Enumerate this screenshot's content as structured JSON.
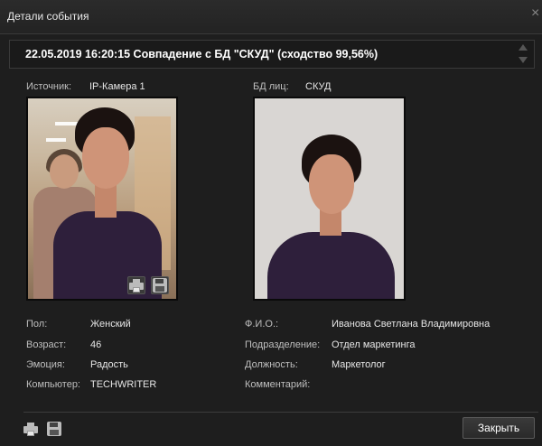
{
  "window": {
    "title": "Детали события",
    "close_glyph": "×"
  },
  "event": {
    "header": "22.05.2019 16:20:15 Совпадение с БД \"СКУД\" (сходство 99,56%)"
  },
  "source": {
    "label": "Источник:",
    "value": "IP-Камера 1"
  },
  "face_db": {
    "label": "БД лиц:",
    "value": "СКУД"
  },
  "details_left": [
    {
      "label": "Пол:",
      "value": "Женский"
    },
    {
      "label": "Возраст:",
      "value": "46"
    },
    {
      "label": "Эмоция:",
      "value": "Радость"
    },
    {
      "label": "Компьютер:",
      "value": "TECHWRITER"
    }
  ],
  "details_right": [
    {
      "label": "Ф.И.О.:",
      "value": "Иванова Светлана Владимировна"
    },
    {
      "label": "Подразделение:",
      "value": "Отдел маркетинга"
    },
    {
      "label": "Должность:",
      "value": "Маркетолог"
    },
    {
      "label": "Комментарий:",
      "value": ""
    }
  ],
  "buttons": {
    "close": "Закрыть"
  },
  "icons": {
    "print": "printer-icon",
    "save": "floppy-icon",
    "scroll_up": "triangle-up-icon",
    "scroll_down": "triangle-down-icon"
  },
  "colors": {
    "background": "#1e1e1e",
    "text": "#e6e6e6",
    "dress": "#2e1f3b"
  }
}
